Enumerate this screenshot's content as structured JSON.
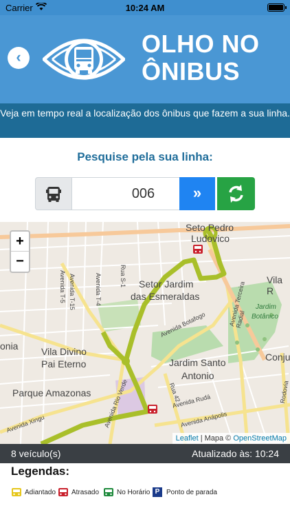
{
  "status_bar": {
    "carrier": "Carrier",
    "time": "10:24 AM"
  },
  "header": {
    "back_label": "‹",
    "logo_line1": "OLHO NO",
    "logo_line2": "ÔNIBUS",
    "tagline": "Veja em tempo real a localização dos ônibus que fazem a sua linha."
  },
  "search": {
    "title": "Pesquise pela sua linha:",
    "line_value": "006",
    "go_label": "»"
  },
  "map": {
    "zoom_in": "+",
    "zoom_out": "−",
    "labels": {
      "seto_pedro": "Seto Pedro",
      "ludovico": "Ludovico",
      "setor_jardim": "Setor Jardim",
      "das_esmeraldas": "das Esmeraldas",
      "vila_r": "Vila R",
      "jardim_botanico": "Jardim",
      "botanico": "Botânico",
      "onia": "onia",
      "vila_divino": "Vila Divino",
      "pai_eterno": "Pai Eterno",
      "jardim_santo": "Jardim Santo",
      "antonio": "Antonio",
      "conju": "Conju",
      "parque_amazonas": "Parque Amazonas",
      "av_t5": "Avenida T-5",
      "av_t15": "Avenida T-15",
      "av_t4": "Avenida T-4",
      "rua_s1": "Rua S-1",
      "av_botafogo": "Avenida Botafogo",
      "av_terceira_radial": "Avenida Terceira Radial",
      "av_rio_verde": "Avenida Rio Verde",
      "av_xingu": "Avenida Xingu",
      "av_ruda": "Avenida Rudá",
      "av_anapolis": "Avenida Anápolis",
      "rua_42": "Rua 42",
      "rodovia": "Rodovia"
    },
    "attribution_leaflet": "Leaflet",
    "attribution_sep": " | Mapa © ",
    "attribution_osm": "OpenStreetMap"
  },
  "info": {
    "vehicle_count": "8 veículo(s)",
    "updated": "Atualizado às: 10:24"
  },
  "legend": {
    "title": "Legendas:",
    "items": [
      {
        "label": "Adiantado",
        "color": "#e6c619"
      },
      {
        "label": "Atrasado",
        "color": "#c9202c"
      },
      {
        "label": "No Horário",
        "color": "#1e8a3c"
      },
      {
        "label": "Ponto de parada",
        "icon": "P"
      }
    ]
  },
  "colors": {
    "header_blue": "#4a97d4",
    "tagline_blue": "#1e6b96",
    "title_blue": "#1f6d9a",
    "go_button": "#1f84f2",
    "refresh_button": "#27a344",
    "route_line": "#a9bf2a",
    "info_bar": "#3a3f44"
  }
}
